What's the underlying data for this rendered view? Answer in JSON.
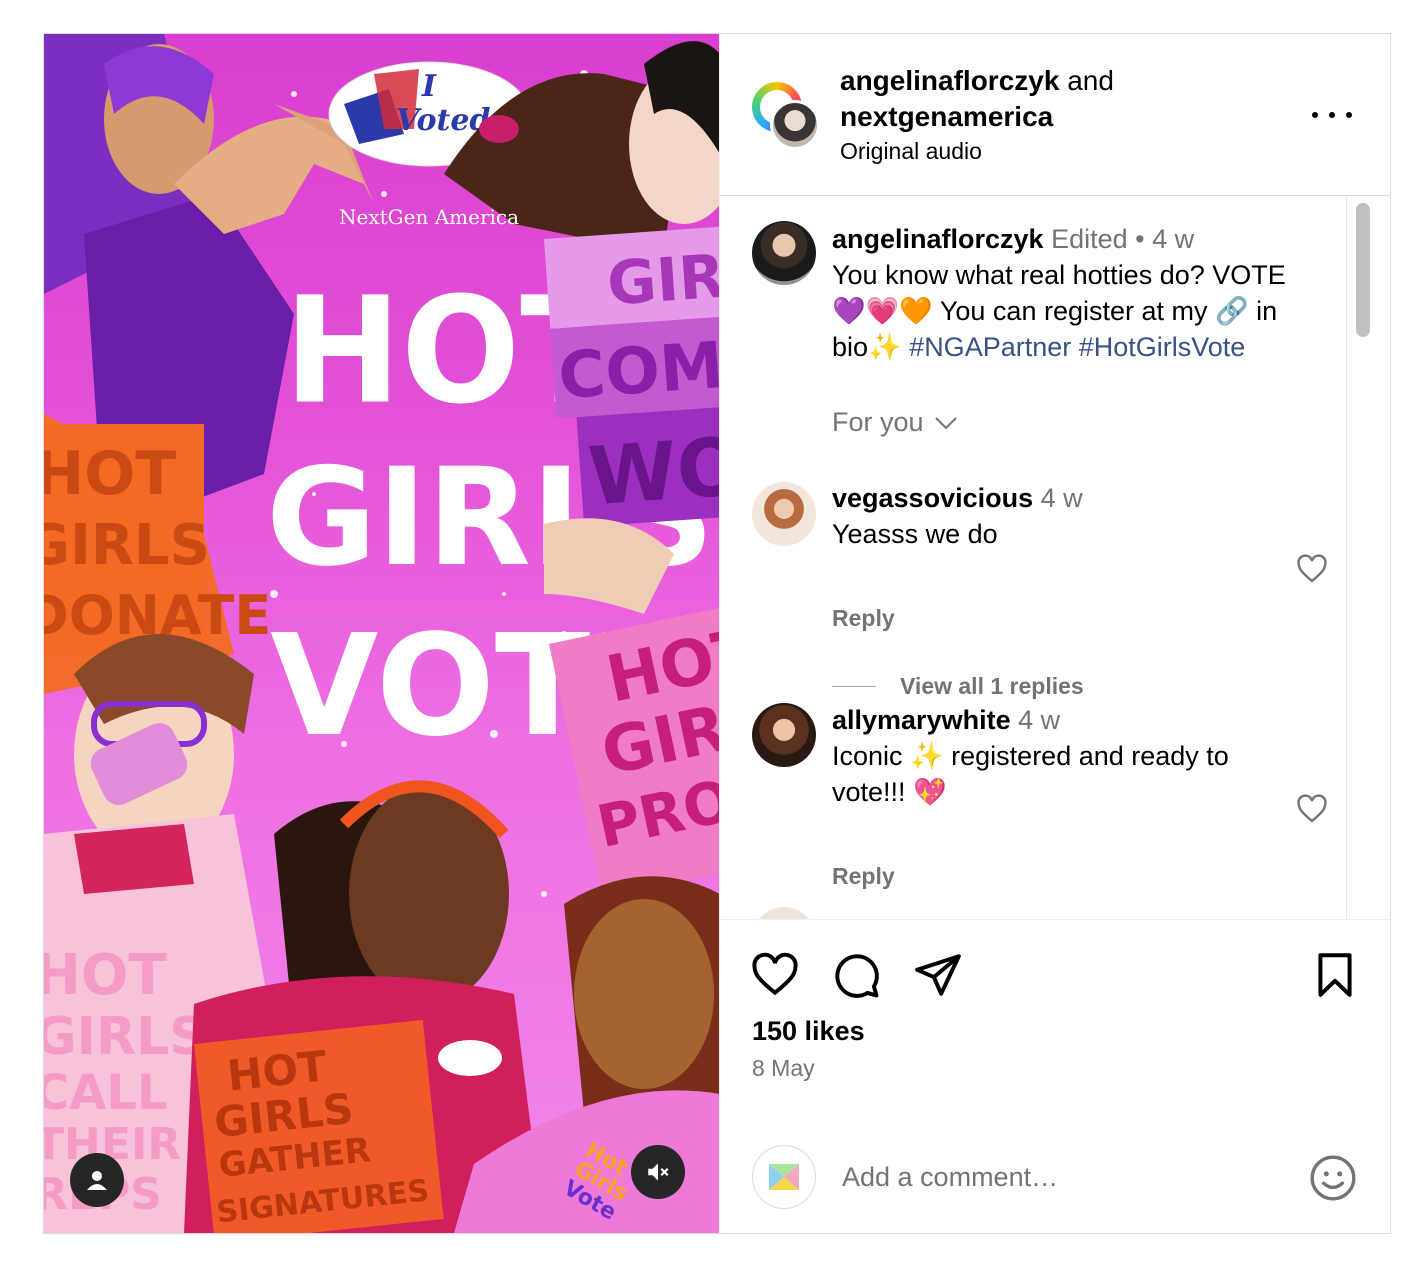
{
  "header": {
    "user1": "angelinaflorczyk",
    "and": "and",
    "user2": "nextgenamerica",
    "audio": "Original audio"
  },
  "media": {
    "brand": "NextGen America",
    "headline": [
      "HOT",
      "GIRLS",
      "VOTE"
    ],
    "sticker": [
      "I",
      "Voted"
    ],
    "sign_community": [
      "HOT",
      "GIRLS",
      "COMMUNITY",
      "WORK"
    ],
    "sign_protest": [
      "HOT",
      "GIRLS",
      "PROTEST"
    ],
    "sign_donate": [
      "HOT",
      "GIRLS",
      "DONATE"
    ],
    "sign_call": [
      "HOT",
      "GIRLS",
      "CALL",
      "THEIR",
      "REPS"
    ],
    "sign_signatures": [
      "HOT",
      "GIRLS",
      "GATHER",
      "SIGNATURES"
    ],
    "shirt_logo": [
      "Hot",
      "Girls",
      "Vote"
    ]
  },
  "caption": {
    "username": "angelinaflorczyk",
    "edited": "Edited",
    "dot": "•",
    "time": "4 w",
    "line1": "You know what real hotties do? VOTE",
    "line2": "💜💗🧡 You can register at my 🔗 in",
    "line3_prefix": "bio✨",
    "hashtags": "#NGAPartner #HotGirlsVote"
  },
  "filter": {
    "label": "For you"
  },
  "comments": [
    {
      "username": "vegassovicious",
      "time": "4 w",
      "text": [
        "Yeasss we do"
      ],
      "reply": "Reply",
      "view_replies": "View all 1 replies"
    },
    {
      "username": "allymarywhite",
      "time": "4 w",
      "text": [
        "Iconic ✨ registered and ready to",
        "vote!!! 💖"
      ],
      "reply": "Reply"
    }
  ],
  "footer": {
    "likes": "150 likes",
    "date": "8 May",
    "comment_placeholder": "Add a comment…"
  },
  "icons": {
    "like": "heart-icon",
    "comment": "comment-bubble-icon",
    "share": "paper-plane-icon",
    "save": "bookmark-icon",
    "more": "ellipsis-icon",
    "emoji": "smiley-icon",
    "tag": "person-icon",
    "mute": "speaker-muted-icon",
    "filter": "chevron-down-icon"
  },
  "colors": {
    "hashtag": "#385185",
    "muted_text": "#737373",
    "border": "#dbdbdb"
  }
}
